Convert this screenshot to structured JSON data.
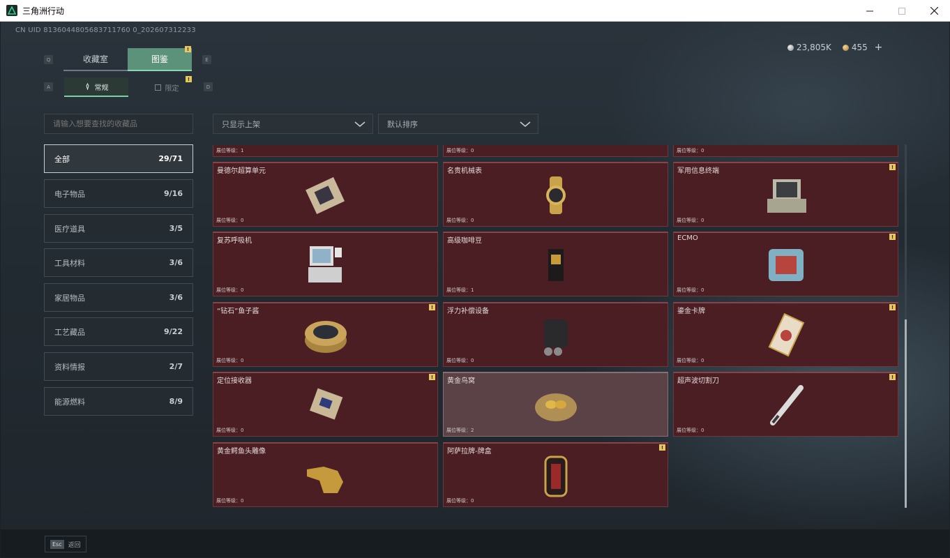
{
  "window": {
    "title": "三角洲行动",
    "minimize": "—",
    "maximize": "☐",
    "close": "✕"
  },
  "uid": "CN UID 8136044805683711760 0_202607312233",
  "currency": {
    "silver": "23,805K",
    "gold": "455",
    "add": "+"
  },
  "tabs": {
    "collection": "收藏室",
    "catalog": "图鉴",
    "key_left": "Q",
    "key_right": "E"
  },
  "subtabs": {
    "normal": "常规",
    "limited": "限定",
    "key_left": "A",
    "key_right": "D"
  },
  "search": {
    "placeholder": "请输入想要查找的收藏品"
  },
  "filters": {
    "show": "只显示上架",
    "sort": "默认排序"
  },
  "categories": [
    {
      "label": "全部",
      "count": "29/71"
    },
    {
      "label": "电子物品",
      "count": "9/16"
    },
    {
      "label": "医疗道具",
      "count": "3/5"
    },
    {
      "label": "工具材料",
      "count": "3/6"
    },
    {
      "label": "家居物品",
      "count": "3/6"
    },
    {
      "label": "工艺藏品",
      "count": "9/22"
    },
    {
      "label": "资料情报",
      "count": "2/7"
    },
    {
      "label": "能源燃料",
      "count": "8/9"
    }
  ],
  "partial_row": [
    {
      "level": "展位等级：1"
    },
    {
      "level": "展位等级：0"
    },
    {
      "level": "展位等级：0"
    }
  ],
  "items": [
    {
      "name": "曼德尔超算单元",
      "level": "展位等级：0",
      "icon": "cpu-chip-icon",
      "warn": false
    },
    {
      "name": "名贵机械表",
      "level": "展位等级：0",
      "icon": "gold-watch-icon",
      "warn": false
    },
    {
      "name": "军用信息终端",
      "level": "展位等级：0",
      "icon": "military-terminal-icon",
      "warn": true
    },
    {
      "name": "复苏呼吸机",
      "level": "展位等级：0",
      "icon": "ventilator-icon",
      "warn": false
    },
    {
      "name": "高级咖啡豆",
      "level": "展位等级：1",
      "icon": "coffee-bag-icon",
      "warn": false
    },
    {
      "name": "ECMO",
      "level": "展位等级：0",
      "icon": "ecmo-machine-icon",
      "warn": true
    },
    {
      "name": "“钻石”鱼子酱",
      "level": "展位等级：0",
      "icon": "caviar-tin-icon",
      "warn": true
    },
    {
      "name": "浮力补偿设备",
      "level": "展位等级：0",
      "icon": "buoyancy-device-icon",
      "warn": false
    },
    {
      "name": "鎏金卡牌",
      "level": "展位等级：0",
      "icon": "gilded-card-icon",
      "warn": true
    },
    {
      "name": "定位接收器",
      "level": "展位等级：0",
      "icon": "receiver-icon",
      "warn": true
    },
    {
      "name": "黄金鸟窝",
      "level": "展位等级：2",
      "icon": "golden-nest-icon",
      "warn": false
    },
    {
      "name": "超声波切割刀",
      "level": "展位等级：0",
      "icon": "ultrasonic-knife-icon",
      "warn": true
    },
    {
      "name": "黄金鳄鱼头雕像",
      "level": "展位等级：0",
      "icon": "crocodile-statue-icon",
      "warn": false
    },
    {
      "name": "阿萨拉牌-牌盒",
      "level": "展位等级：0",
      "icon": "card-box-icon",
      "warn": true
    }
  ],
  "footer": {
    "key": "Esc",
    "label": "返回"
  },
  "colors": {
    "accent": "#5c9279",
    "item_bg": "#4a1e22",
    "warn": "#e8c85a"
  }
}
